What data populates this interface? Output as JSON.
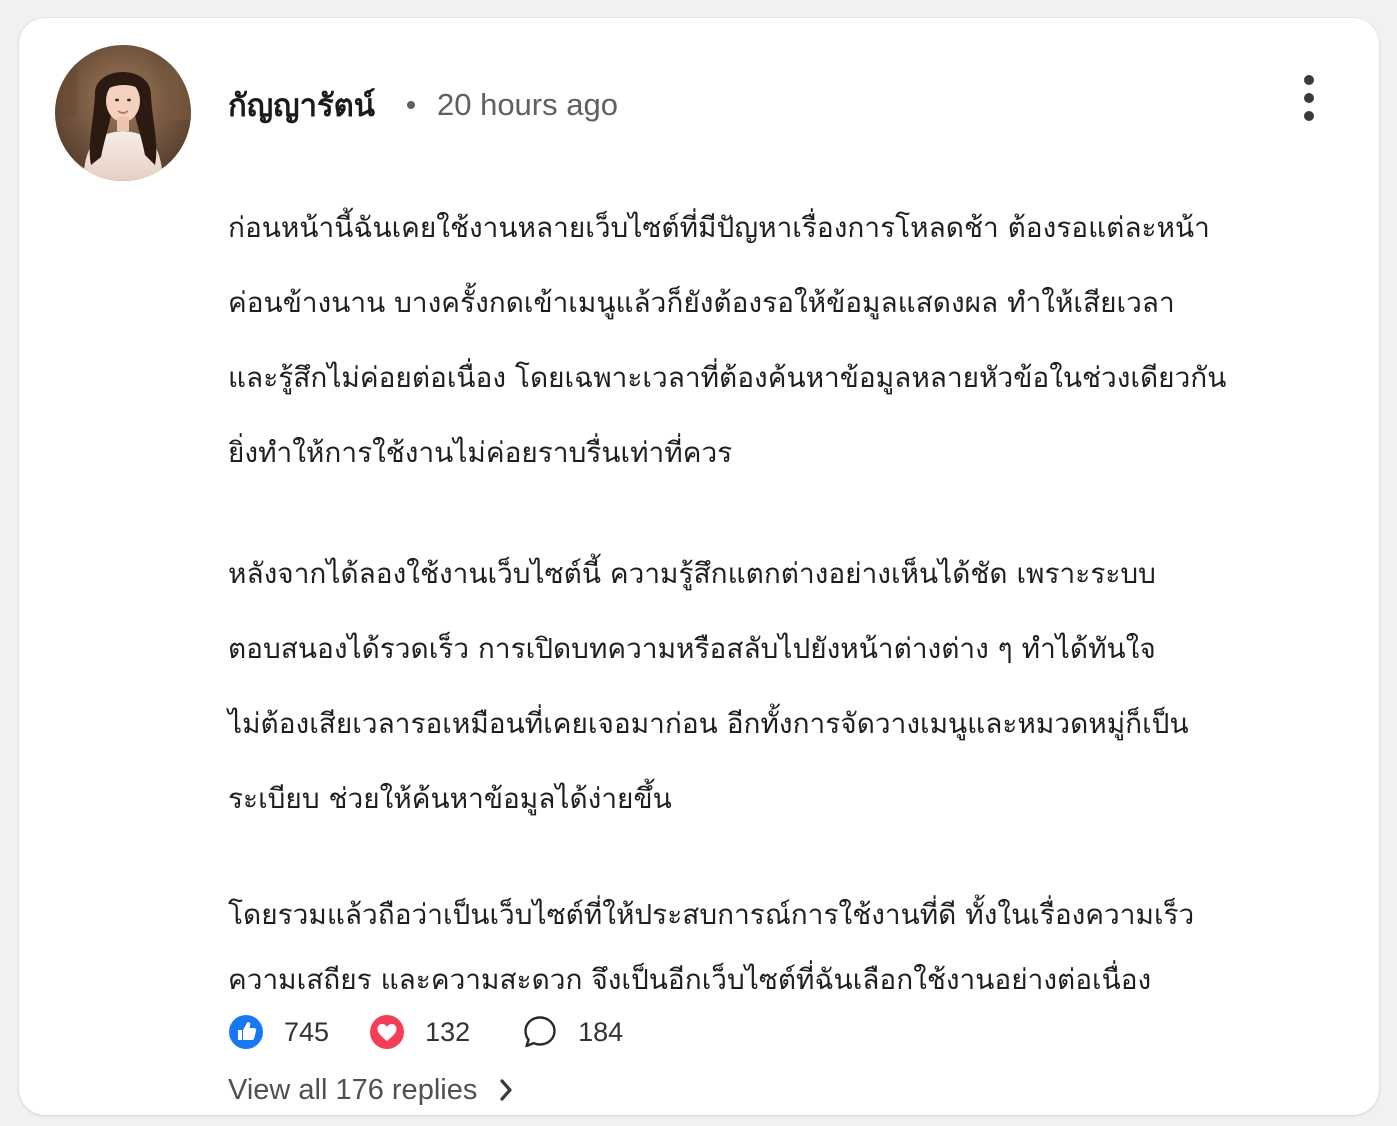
{
  "comment": {
    "author": "กัญญารัตน์",
    "timestamp": "20 hours ago",
    "avatar": "profile-photo",
    "paragraphs": [
      [
        "ก่อนหน้านี้ฉันเคยใช้งานหลายเว็บไซต์ที่มีปัญหาเรื่องการโหลดช้า ต้องรอแต่ละหน้า",
        "ค่อนข้างนาน บางครั้งกดเข้าเมนูแล้วก็ยังต้องรอให้ข้อมูลแสดงผล ทำให้เสียเวลา",
        "และรู้สึกไม่ค่อยต่อเนื่อง โดยเฉพาะเวลาที่ต้องค้นหาข้อมูลหลายหัวข้อในช่วงเดียวกัน",
        "ยิ่งทำให้การใช้งานไม่ค่อยราบรื่นเท่าที่ควร"
      ],
      [
        "หลังจากได้ลองใช้งานเว็บไซต์นี้ ความรู้สึกแตกต่างอย่างเห็นได้ชัด เพราะระบบ",
        "ตอบสนองได้รวดเร็ว การเปิดบทความหรือสลับไปยังหน้าต่างต่าง ๆ ทำได้ทันใจ",
        "ไม่ต้องเสียเวลารอเหมือนที่เคยเจอมาก่อน อีกทั้งการจัดวางเมนูและหมวดหมู่ก็เป็น",
        "ระเบียบ ช่วยให้ค้นหาข้อมูลได้ง่ายขึ้น"
      ],
      [
        "โดยรวมแล้วถือว่าเป็นเว็บไซต์ที่ให้ประสบการณ์การใช้งานที่ดี ทั้งในเรื่องความเร็ว",
        "ความเสถียร และความสะดวก จึงเป็นอีกเว็บไซต์ที่ฉันเลือกใช้งานอย่างต่อเนื่อง"
      ]
    ],
    "reactions": {
      "like": {
        "icon": "thumbs-up-icon",
        "count": "745",
        "color": "#1877f2"
      },
      "love": {
        "icon": "heart-icon",
        "count": "132",
        "color": "#f33e58"
      },
      "comments": {
        "icon": "comment-bubble-icon",
        "count": "184"
      }
    },
    "replies_link": "View all 176 replies",
    "more_icon": "more-vertical-icon"
  }
}
